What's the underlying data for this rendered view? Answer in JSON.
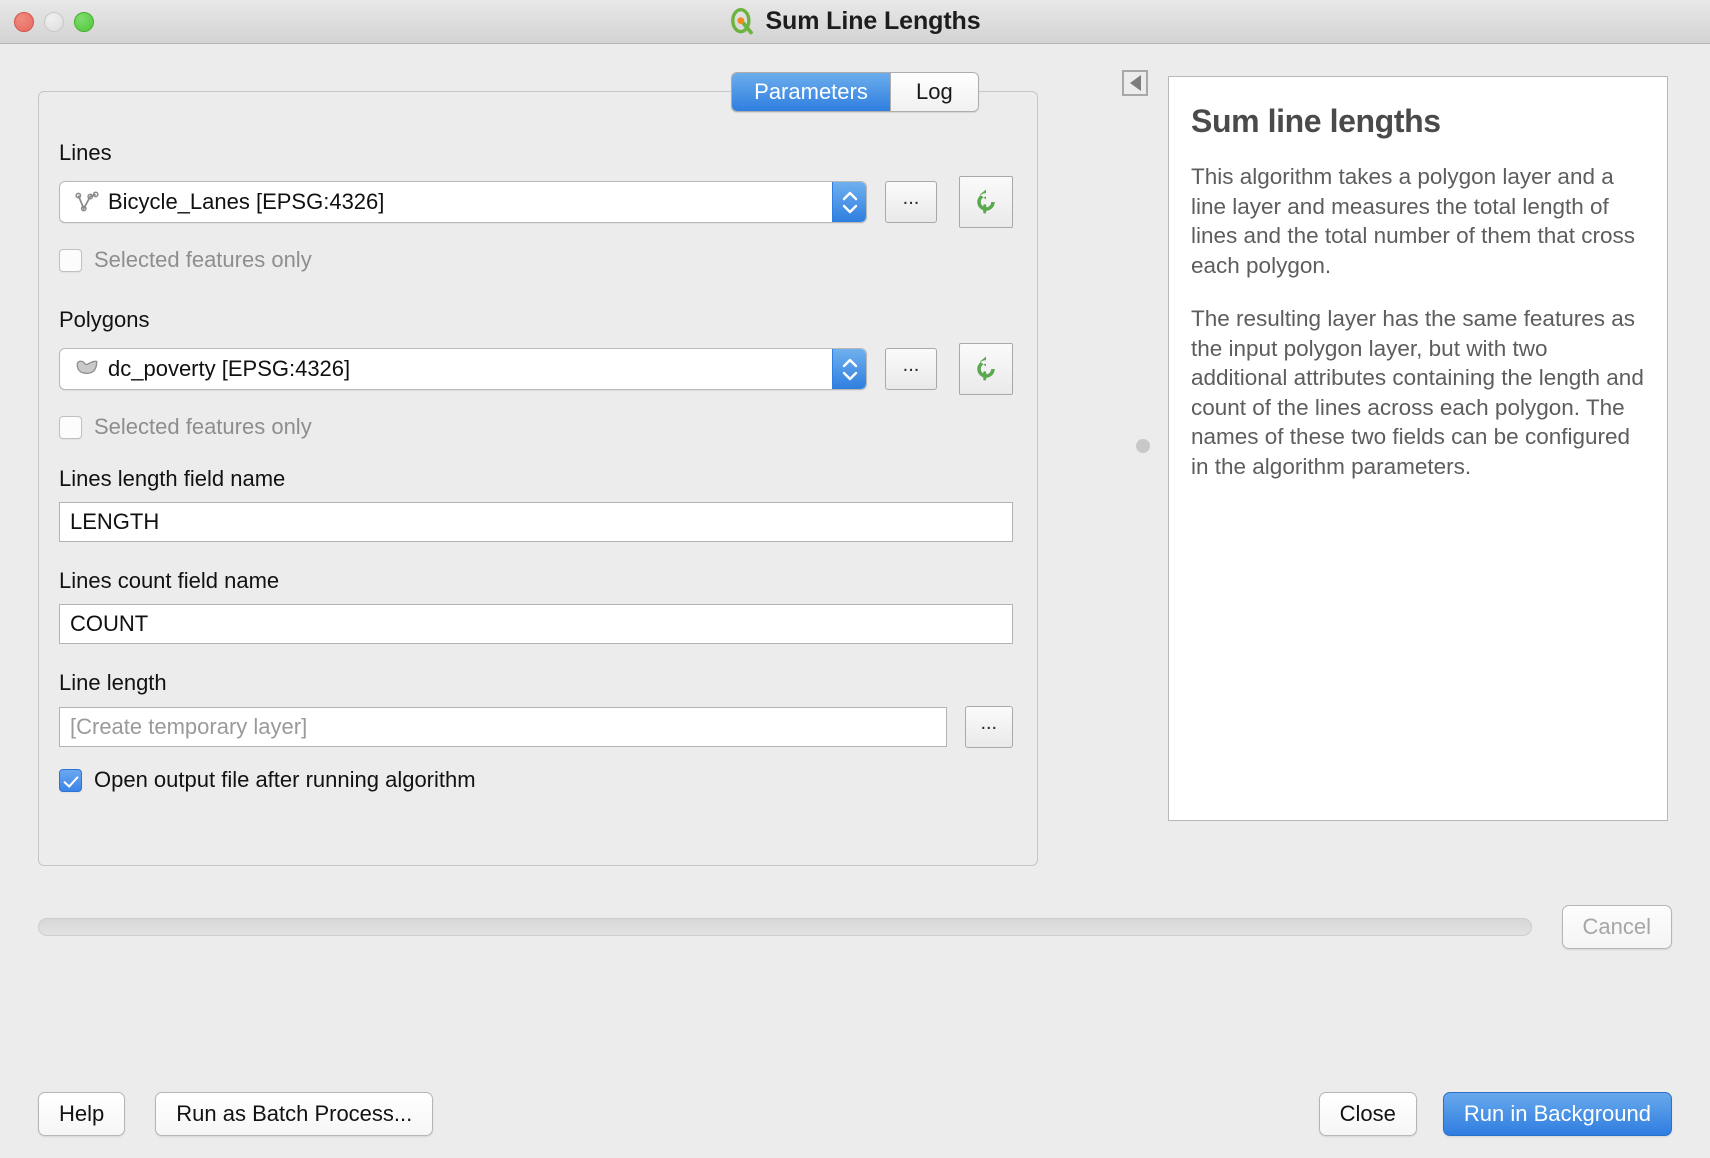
{
  "window": {
    "title": "Sum Line Lengths",
    "traffic_lights": [
      "close-button",
      "minimize-button",
      "zoom-button"
    ],
    "app_icon": "qgis-logo-icon"
  },
  "tabs": [
    {
      "label": "Parameters",
      "active": true
    },
    {
      "label": "Log",
      "active": false
    }
  ],
  "parameters": {
    "lines": {
      "label": "Lines",
      "value": "Bicycle_Lanes [EPSG:4326]",
      "icon": "line-layer-icon",
      "browse_label": "...",
      "refresh_icon": "refresh-icon",
      "selected_only": {
        "label": "Selected features only",
        "checked": false,
        "disabled": true
      }
    },
    "polygons": {
      "label": "Polygons",
      "value": "dc_poverty [EPSG:4326]",
      "icon": "polygon-layer-icon",
      "browse_label": "...",
      "refresh_icon": "refresh-icon",
      "selected_only": {
        "label": "Selected features only",
        "checked": false,
        "disabled": true
      }
    },
    "length_field": {
      "label": "Lines length field name",
      "value": "LENGTH"
    },
    "count_field": {
      "label": "Lines count field name",
      "value": "COUNT"
    },
    "output": {
      "label": "Line length",
      "placeholder": "[Create temporary layer]",
      "value": "",
      "browse_label": "..."
    },
    "open_output": {
      "label": "Open output file after running algorithm",
      "checked": true
    }
  },
  "help": {
    "title": "Sum line lengths",
    "paragraphs": [
      "This algorithm takes a polygon layer and a line layer and measures the total length of lines and the total number of them that cross each polygon.",
      "The resulting layer has the same features as the input polygon layer, but with two additional attributes containing the length and count of the lines across each polygon. The names of these two fields can be configured in the algorithm parameters."
    ],
    "collapse_icon": "collapse-left-icon"
  },
  "progress": {
    "percent": 0,
    "cancel_label": "Cancel",
    "cancel_disabled": true
  },
  "buttons": {
    "help": "Help",
    "run_batch": "Run as Batch Process...",
    "close": "Close",
    "run_background": "Run in Background"
  },
  "colors": {
    "accent": "#2f7fe0",
    "window_bg": "#ececec",
    "panel_bg": "#ffffff",
    "help_text": "#5d5d5d",
    "refresh_green": "#5aa84f"
  }
}
